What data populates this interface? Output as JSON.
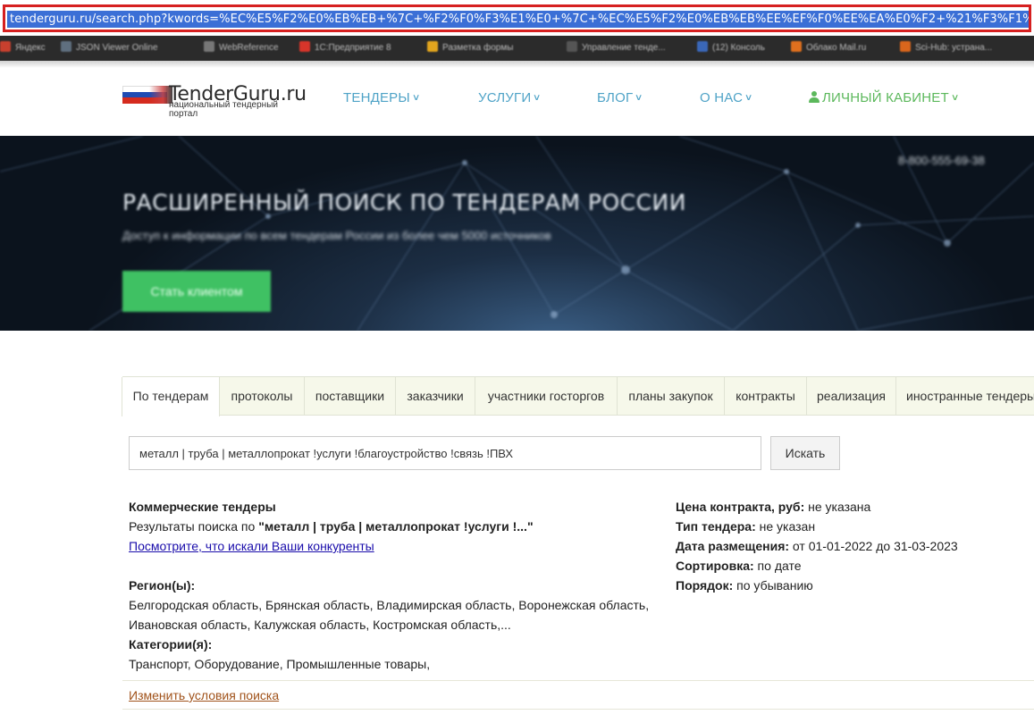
{
  "browser": {
    "url": "tenderguru.ru/search.php?kwords=%EC%E5%F2%E0%EB%EB+%7C+%F2%F0%F3%E1%E0+%7C+%EC%E5%F2%E0%EB%EB%EE%EF%F0%EE%EA%E0%F2+%21%F3%F1%EB%F3%E3%E8+%21"
  },
  "bookmarks": [
    {
      "label": "Яндекс",
      "color": "#c8402e"
    },
    {
      "label": "JSON Viewer Online",
      "color": "#5f6f7f"
    },
    {
      "label": "WebReference",
      "color": "#777777"
    },
    {
      "label": "1С:Предприятие 8",
      "color": "#d8352a"
    },
    {
      "label": "Разметка формы",
      "color": "#e2a51e"
    },
    {
      "label": "Управление тенде...",
      "color": "#555555"
    },
    {
      "label": "(12) Консоль",
      "color": "#3a67b8"
    },
    {
      "label": "Облако Mail.ru",
      "color": "#e0701e"
    },
    {
      "label": "Sci-Hub: устрана...",
      "color": "#d9661c"
    }
  ],
  "site": {
    "logo_title": "TenderGuru.ru",
    "logo_subtitle": "национальный тендерный портал"
  },
  "nav": {
    "tenders": "ТЕНДЕРЫ",
    "services": "УСЛУГИ",
    "blog": "БЛОГ",
    "about": "О НАС",
    "cabinet": "ЛИЧНЫЙ КАБИНЕТ"
  },
  "hero": {
    "title": "РАСШИРЕННЫЙ ПОИСК ПО ТЕНДЕРАМ РОССИИ",
    "subtitle": "Доступ к информации по всем тендерам России из более чем 5000 источников",
    "phone": "8-800-555-69-38",
    "button": "Стать клиентом"
  },
  "tabs": [
    "По тендерам",
    "протоколы",
    "поставщики",
    "заказчики",
    "участники госторгов",
    "планы закупок",
    "контракты",
    "реализация",
    "иностранные тендеры"
  ],
  "search": {
    "value": "металл | труба | металлопрокат !услуги !благоустройство !связь !ПВХ",
    "button": "Искать"
  },
  "results": {
    "heading": "Коммерческие тендеры",
    "query_prefix": "Результаты поиска по ",
    "query_text": "\"металл | труба | металлопрокат !услуги !...\"",
    "competitors_link": "Посмотрите, что искали Ваши конкуренты",
    "regions_label": "Регион(ы):",
    "regions_line1": "Белгородская область, Брянская область, Владимирская область, Воронежская область,",
    "regions_line2": "Ивановская область, Калужская область, Костромская область,...",
    "categories_label": "Категории(я):",
    "categories_value": "Транспорт, Оборудование, Промышленные товары,",
    "price_label": "Цена контракта, руб:",
    "price_value": " не указана",
    "type_label": "Тип тендера:",
    "type_value": " не указан",
    "date_label": "Дата размещения:",
    "date_value": " от 01-01-2022 до 31-03-2023",
    "sort_label": "Сортировка:",
    "sort_value": " по дате",
    "order_label": "Порядок:",
    "order_value": " по убыванию",
    "change_link": "Изменить условия поиска"
  },
  "colors": {
    "nav_blue": "#4fa3c7",
    "cabinet_green": "#5cb85c",
    "hero_button": "#3fc163",
    "tabs_bg": "#f6f8ea"
  }
}
